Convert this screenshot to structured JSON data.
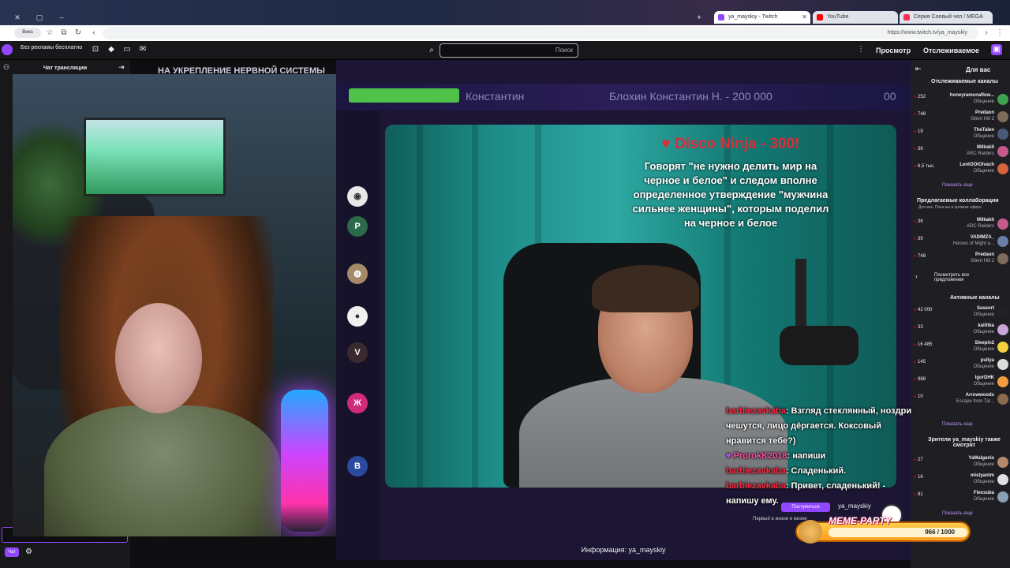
{
  "browser": {
    "tabs": [
      {
        "label": "Серия Соевый чел / MEGA",
        "active": false
      },
      {
        "label": "YouTube",
        "active": false
      },
      {
        "label": "ya_mayskiy - Twitch",
        "active": true
      }
    ],
    "url": "https://www.twitch.tv/ya_mayskiy",
    "profile_label": "Вика"
  },
  "topbar": {
    "following": "Отслеживаемое",
    "browse": "Просмотр",
    "search_placeholder": "Поиск",
    "adfree": "Без рекламы бесплатно"
  },
  "left_chat": {
    "header": "Чат трансляции",
    "chat_button": "Чат"
  },
  "stage": {
    "top_caption": "НА УКРЕПЛЕНИЕ НЕРВНОЙ СИСТЕМЫ",
    "ticker": [
      "Блохин Константин Н. - 200 000",
      "Константин",
      "00"
    ],
    "donation_title": "♥ Disco Ninja - 300!",
    "donation_text": "Говорят \"не нужно делить мир на черное и белое\" и следом вполне определенное утверждение \"мужчина сильнее женщины\", которым поделил на черное и белое",
    "side_avatars": [
      "Р",
      "V",
      "Ж",
      "В"
    ],
    "overlay_chat": [
      {
        "user": "barbiezavkaba",
        "text": ": Взгляд стеклянный, ноздри чешутся, лицо дёргается. Коксовый нравится тебе?)",
        "badge": false
      },
      {
        "user": "ProrokK2018",
        "text": ": напиши",
        "badge": true
      },
      {
        "user": "barbiezavkaba",
        "text": ": Сладенький.",
        "badge": false
      },
      {
        "user": "barbiezavkaba",
        "text": ": Привет, сладенький! - напишу ему.",
        "badge": false
      }
    ],
    "meme_party": {
      "title": "MEME-PARTY",
      "progress": "966 / 1000",
      "progress_value": 0.966
    },
    "follow_button": "Поступиться",
    "channel_name": "ya_mayskiy",
    "channel_sub": "Первый в жизни и жизни",
    "info_caption": "Информация: ya_mayskiy"
  },
  "sidebar": {
    "for_you": "Для вас",
    "followed_header": "Отслеживаемые каналы",
    "followed": [
      {
        "name": "honeyramonaflow...",
        "game": "Общение",
        "count": "252",
        "color": "#3fa34d"
      },
      {
        "name": "Predaon",
        "game": "Silent Hill 2",
        "count": "748",
        "color": "#7d6b5c"
      },
      {
        "name": "TheTalen",
        "game": "Общение",
        "count": "19",
        "color": "#4a5a7a"
      },
      {
        "name": "Milkakit",
        "game": "ARC Raiders",
        "count": "36",
        "color": "#c55a8a"
      },
      {
        "name": "LentOOlOlvach",
        "game": "Общение",
        "count": "6,5 тыс.",
        "color": "#d8643a"
      }
    ],
    "show_more": "Показать еще",
    "recommended_header": "Предлагаемые коллаборации",
    "recommended_sub": "Для вас. Пока вы в прямом эфире.",
    "recommended": [
      {
        "name": "Milkakit",
        "game": "ARC Raiders",
        "count": "36",
        "color": "#c55a8a"
      },
      {
        "name": "VADIMZA_",
        "game": "Heroes of Might a...",
        "count": "39",
        "color": "#6b7ea5"
      },
      {
        "name": "Predaon",
        "game": "Silent Hill 2",
        "count": "748",
        "color": "#7d6b5c"
      }
    ],
    "see_all": "Посмотреть все предложения",
    "active_header": "Активные каналы",
    "active": [
      {
        "name": "Saseort",
        "game": "Общение",
        "count": "42 000",
        "color": "#222222"
      },
      {
        "name": "kalittka",
        "game": "Общение",
        "count": "33",
        "color": "#c9a4d9"
      },
      {
        "name": "Sleepin2",
        "game": "Общение",
        "count": "16 485",
        "color": "#f4d03f"
      },
      {
        "name": "pullya",
        "game": "Общение",
        "count": "145",
        "color": "#dddddd"
      },
      {
        "name": "IgorDHK",
        "game": "Общение",
        "count": "988",
        "color": "#f39c3d"
      },
      {
        "name": "Arrowwoods",
        "game": "Escape from Tar...",
        "count": "10",
        "color": "#8a6a4a"
      }
    ],
    "watching_header": "Зрители ya_mayskiy также смотрят",
    "watching": [
      {
        "name": "YaMalganis",
        "game": "Общение",
        "count": "27",
        "color": "#b48a6a"
      },
      {
        "name": "mistyantm",
        "game": "Общение",
        "count": "16",
        "color": "#e0e0e0"
      },
      {
        "name": "Flexsuba",
        "game": "Общение",
        "count": "81",
        "color": "#8aa0b5"
      }
    ]
  }
}
